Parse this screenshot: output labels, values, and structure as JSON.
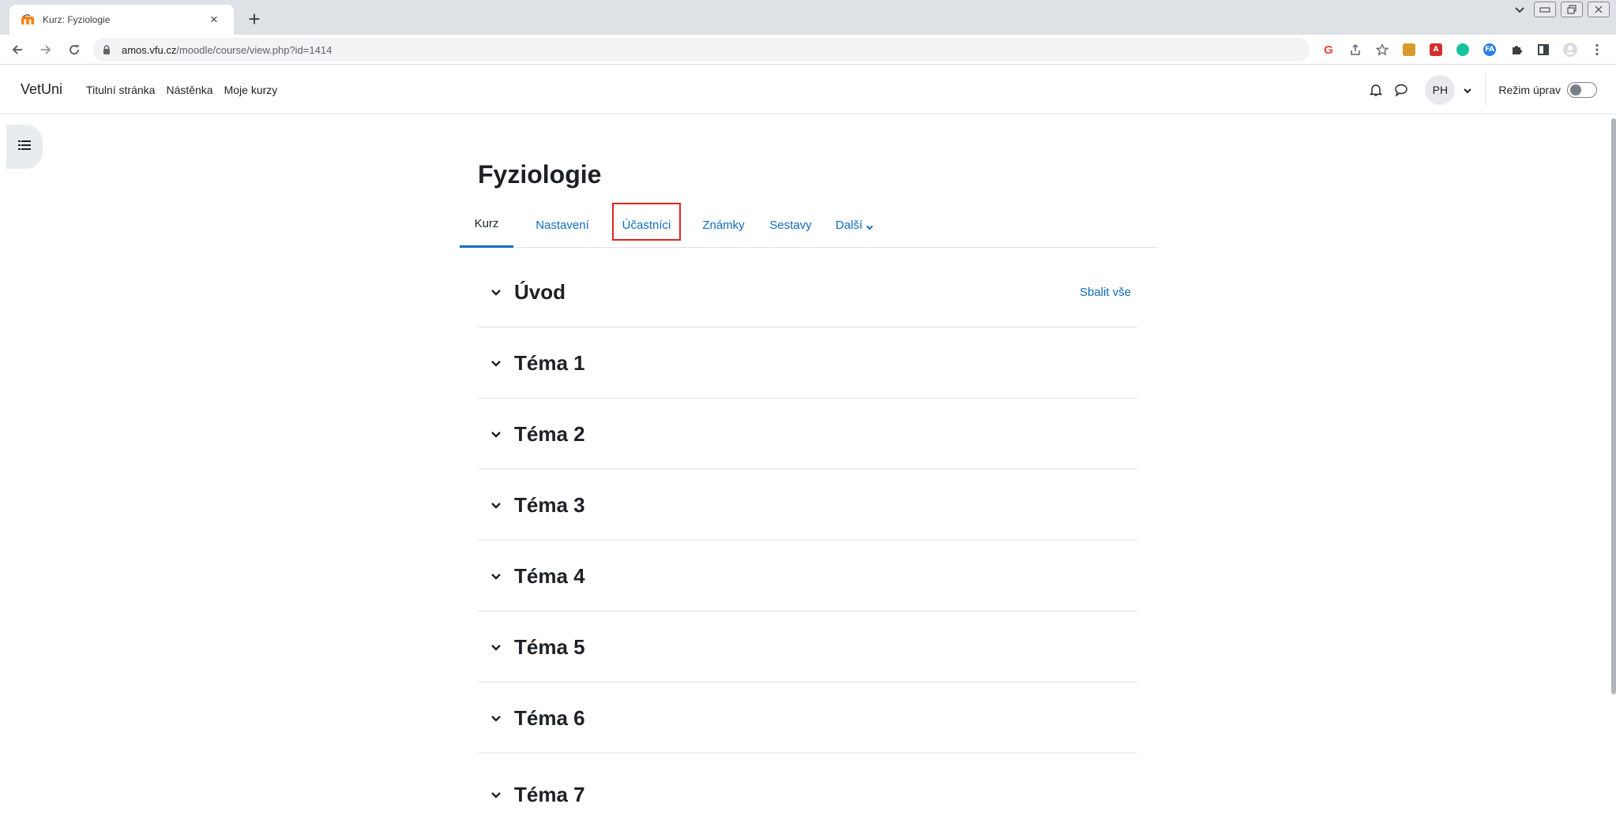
{
  "browser": {
    "tab_title": "Kurz: Fyziologie",
    "tab_close": "×",
    "new_tab": "+",
    "url_host": "amos.vfu.cz",
    "url_path": "/moodle/course/view.php?id=1414",
    "extensions": [
      {
        "icon": "google-g-icon",
        "label": "G",
        "color": "#ea4335"
      },
      {
        "icon": "share-icon"
      },
      {
        "icon": "bookmark-star-icon"
      },
      {
        "icon": "extension-colored-icon",
        "color": "#d79b2b"
      },
      {
        "icon": "pdf-icon",
        "color": "#d32f2f"
      },
      {
        "icon": "grammarly-icon",
        "color": "#15c39a"
      },
      {
        "icon": "fa-extension-icon",
        "label": "FA",
        "color": "#2b7de9"
      },
      {
        "icon": "puzzle-icon"
      },
      {
        "icon": "side-panel-icon"
      },
      {
        "icon": "profile-icon"
      },
      {
        "icon": "kebab-menu-icon"
      }
    ]
  },
  "navbar": {
    "brand": "VetUni",
    "links": [
      "Titulní stránka",
      "Nástěnka",
      "Moje kurzy"
    ],
    "avatar_initials": "PH",
    "edit_mode_label": "Režim úprav",
    "edit_mode_on": false
  },
  "course": {
    "title": "Fyziologie",
    "secondary_nav": [
      {
        "label": "Kurz",
        "active": true
      },
      {
        "label": "Nastavení",
        "active": false
      },
      {
        "label": "Účastníci",
        "active": false,
        "highlighted": true
      },
      {
        "label": "Známky",
        "active": false
      },
      {
        "label": "Sestavy",
        "active": false
      },
      {
        "label": "Další",
        "active": false,
        "dropdown": true
      }
    ],
    "collapse_all": "Sbalit vše",
    "sections": [
      "Úvod",
      "Téma 1",
      "Téma 2",
      "Téma 3",
      "Téma 4",
      "Téma 5",
      "Téma 6",
      "Téma 7"
    ]
  },
  "colors": {
    "link": "#0f6cbf",
    "highlight": "#e02424",
    "text": "#1d2125"
  }
}
